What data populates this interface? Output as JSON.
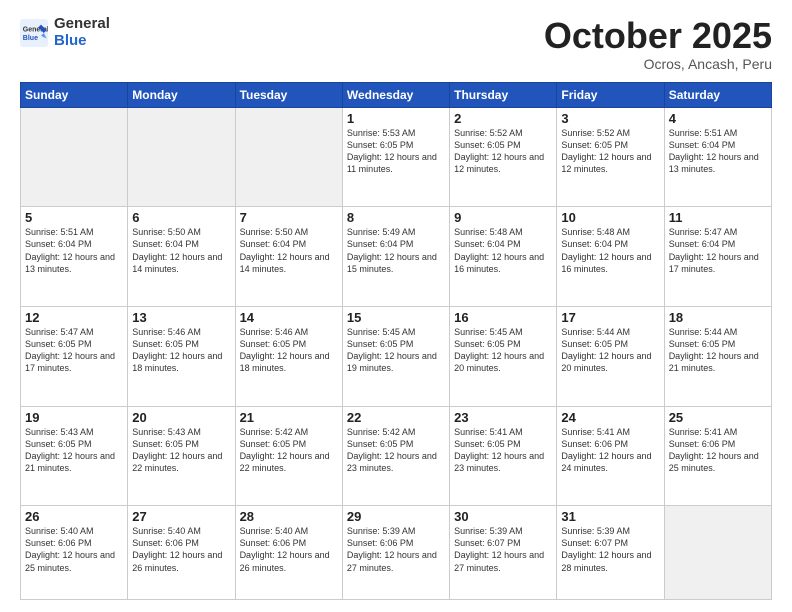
{
  "logo": {
    "general": "General",
    "blue": "Blue"
  },
  "header": {
    "month": "October 2025",
    "location": "Ocros, Ancash, Peru"
  },
  "weekdays": [
    "Sunday",
    "Monday",
    "Tuesday",
    "Wednesday",
    "Thursday",
    "Friday",
    "Saturday"
  ],
  "weeks": [
    [
      {
        "day": "",
        "empty": true
      },
      {
        "day": "",
        "empty": true
      },
      {
        "day": "",
        "empty": true
      },
      {
        "day": "1",
        "sunrise": "5:53 AM",
        "sunset": "6:05 PM",
        "daylight": "12 hours and 11 minutes."
      },
      {
        "day": "2",
        "sunrise": "5:52 AM",
        "sunset": "6:05 PM",
        "daylight": "12 hours and 12 minutes."
      },
      {
        "day": "3",
        "sunrise": "5:52 AM",
        "sunset": "6:05 PM",
        "daylight": "12 hours and 12 minutes."
      },
      {
        "day": "4",
        "sunrise": "5:51 AM",
        "sunset": "6:04 PM",
        "daylight": "12 hours and 13 minutes."
      }
    ],
    [
      {
        "day": "5",
        "sunrise": "5:51 AM",
        "sunset": "6:04 PM",
        "daylight": "12 hours and 13 minutes."
      },
      {
        "day": "6",
        "sunrise": "5:50 AM",
        "sunset": "6:04 PM",
        "daylight": "12 hours and 14 minutes."
      },
      {
        "day": "7",
        "sunrise": "5:50 AM",
        "sunset": "6:04 PM",
        "daylight": "12 hours and 14 minutes."
      },
      {
        "day": "8",
        "sunrise": "5:49 AM",
        "sunset": "6:04 PM",
        "daylight": "12 hours and 15 minutes."
      },
      {
        "day": "9",
        "sunrise": "5:48 AM",
        "sunset": "6:04 PM",
        "daylight": "12 hours and 16 minutes."
      },
      {
        "day": "10",
        "sunrise": "5:48 AM",
        "sunset": "6:04 PM",
        "daylight": "12 hours and 16 minutes."
      },
      {
        "day": "11",
        "sunrise": "5:47 AM",
        "sunset": "6:04 PM",
        "daylight": "12 hours and 17 minutes."
      }
    ],
    [
      {
        "day": "12",
        "sunrise": "5:47 AM",
        "sunset": "6:05 PM",
        "daylight": "12 hours and 17 minutes."
      },
      {
        "day": "13",
        "sunrise": "5:46 AM",
        "sunset": "6:05 PM",
        "daylight": "12 hours and 18 minutes."
      },
      {
        "day": "14",
        "sunrise": "5:46 AM",
        "sunset": "6:05 PM",
        "daylight": "12 hours and 18 minutes."
      },
      {
        "day": "15",
        "sunrise": "5:45 AM",
        "sunset": "6:05 PM",
        "daylight": "12 hours and 19 minutes."
      },
      {
        "day": "16",
        "sunrise": "5:45 AM",
        "sunset": "6:05 PM",
        "daylight": "12 hours and 20 minutes."
      },
      {
        "day": "17",
        "sunrise": "5:44 AM",
        "sunset": "6:05 PM",
        "daylight": "12 hours and 20 minutes."
      },
      {
        "day": "18",
        "sunrise": "5:44 AM",
        "sunset": "6:05 PM",
        "daylight": "12 hours and 21 minutes."
      }
    ],
    [
      {
        "day": "19",
        "sunrise": "5:43 AM",
        "sunset": "6:05 PM",
        "daylight": "12 hours and 21 minutes."
      },
      {
        "day": "20",
        "sunrise": "5:43 AM",
        "sunset": "6:05 PM",
        "daylight": "12 hours and 22 minutes."
      },
      {
        "day": "21",
        "sunrise": "5:42 AM",
        "sunset": "6:05 PM",
        "daylight": "12 hours and 22 minutes."
      },
      {
        "day": "22",
        "sunrise": "5:42 AM",
        "sunset": "6:05 PM",
        "daylight": "12 hours and 23 minutes."
      },
      {
        "day": "23",
        "sunrise": "5:41 AM",
        "sunset": "6:05 PM",
        "daylight": "12 hours and 23 minutes."
      },
      {
        "day": "24",
        "sunrise": "5:41 AM",
        "sunset": "6:06 PM",
        "daylight": "12 hours and 24 minutes."
      },
      {
        "day": "25",
        "sunrise": "5:41 AM",
        "sunset": "6:06 PM",
        "daylight": "12 hours and 25 minutes."
      }
    ],
    [
      {
        "day": "26",
        "sunrise": "5:40 AM",
        "sunset": "6:06 PM",
        "daylight": "12 hours and 25 minutes."
      },
      {
        "day": "27",
        "sunrise": "5:40 AM",
        "sunset": "6:06 PM",
        "daylight": "12 hours and 26 minutes."
      },
      {
        "day": "28",
        "sunrise": "5:40 AM",
        "sunset": "6:06 PM",
        "daylight": "12 hours and 26 minutes."
      },
      {
        "day": "29",
        "sunrise": "5:39 AM",
        "sunset": "6:06 PM",
        "daylight": "12 hours and 27 minutes."
      },
      {
        "day": "30",
        "sunrise": "5:39 AM",
        "sunset": "6:07 PM",
        "daylight": "12 hours and 27 minutes."
      },
      {
        "day": "31",
        "sunrise": "5:39 AM",
        "sunset": "6:07 PM",
        "daylight": "12 hours and 28 minutes."
      },
      {
        "day": "",
        "empty": true
      }
    ]
  ]
}
